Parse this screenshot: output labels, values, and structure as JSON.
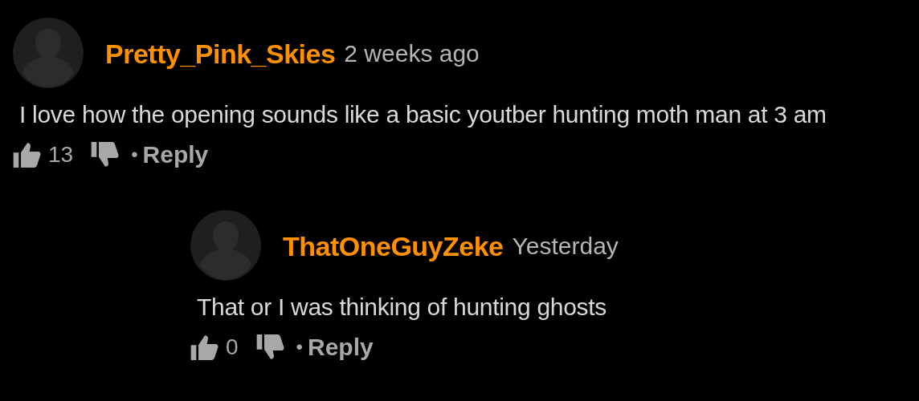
{
  "comments": [
    {
      "username": "Pretty_Pink_Skies",
      "time": "2 weeks ago",
      "text": "I love how the opening sounds like a basic youtber hunting moth man at 3 am",
      "likes": "13",
      "separator": "•",
      "reply": "Reply",
      "children": [
        {
          "username": "ThatOneGuyZeke",
          "time": "Yesterday",
          "text": "That or I was thinking of hunting ghosts",
          "likes": "0",
          "separator": "•",
          "reply": "Reply"
        }
      ]
    }
  ]
}
